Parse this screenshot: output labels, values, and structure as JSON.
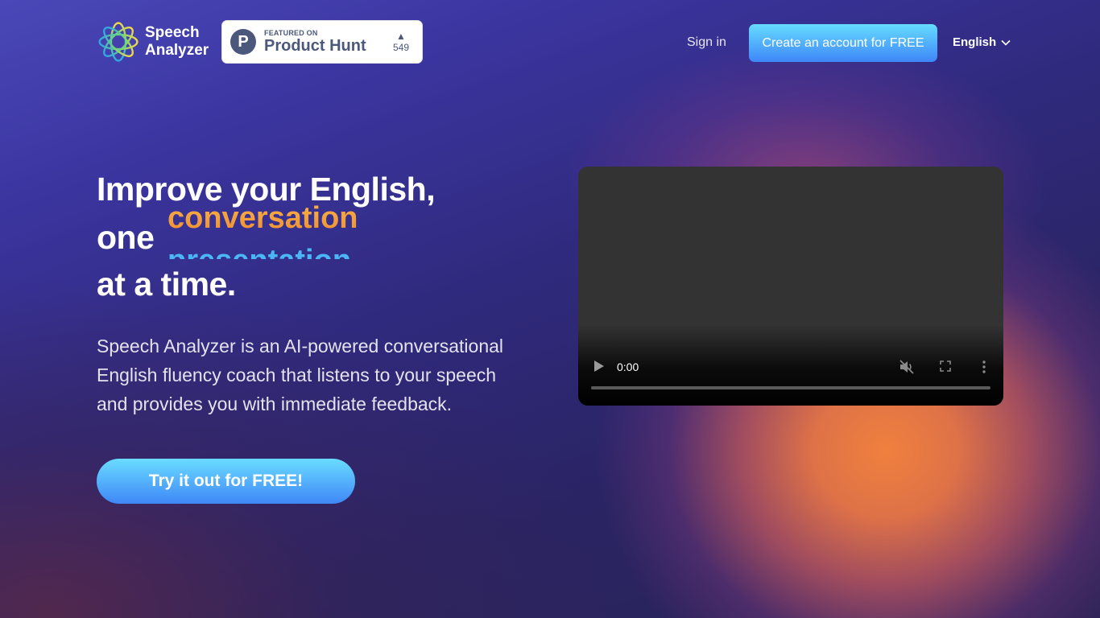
{
  "header": {
    "brand": {
      "line1": "Speech",
      "line2": "Analyzer",
      "icon": "star-flower-logo-icon"
    },
    "product_hunt": {
      "featured_label": "FEATURED ON",
      "name": "Product Hunt",
      "logo_letter": "P",
      "upvote_icon": "triangle-up-icon",
      "votes": "549"
    },
    "signin_label": "Sign in",
    "create_account_label": "Create an account for FREE",
    "language": {
      "selected": "English",
      "icon": "chevron-down-icon"
    }
  },
  "hero": {
    "line1": "Improve your English,",
    "line2_prefix": "one",
    "rotating_words": [
      "conversation",
      "presentation"
    ],
    "line3": "at a time.",
    "description": "Speech Analyzer is an AI-powered conversational English fluency coach that listens to your speech and provides you with immediate feedback.",
    "cta_label": "Try it out for FREE!"
  },
  "video": {
    "time": "0:00",
    "progress": 0,
    "muted": true,
    "controls": [
      "play-icon",
      "mute-icon",
      "fullscreen-icon",
      "more-options-icon"
    ]
  },
  "colors": {
    "accent_blue_top": "#66dcff",
    "accent_blue_bottom": "#3e86f8",
    "rotating_orange": "#f5a23c",
    "rotating_blue": "#4bb6f5",
    "bg_indigo": "#302a7e",
    "glow_orange": "#f0803e"
  }
}
